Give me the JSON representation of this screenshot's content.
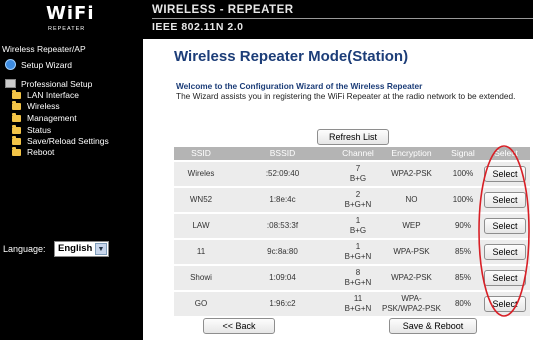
{
  "header": {
    "logo_text": "WiFi",
    "logo_sub": "REPEATER",
    "title": "WIRELESS - REPEATER",
    "subtitle": "IEEE 802.11N 2.0"
  },
  "sidebar": {
    "heading": "Wireless Repeater/AP",
    "items": [
      {
        "label": "Setup Wizard",
        "icon": "globe-icon"
      },
      {
        "label": "Professional Setup",
        "icon": "setup-icon"
      },
      {
        "label": "LAN Interface",
        "icon": "folder-icon"
      },
      {
        "label": "Wireless",
        "icon": "folder-icon"
      },
      {
        "label": "Management",
        "icon": "folder-icon"
      },
      {
        "label": "Status",
        "icon": "folder-icon"
      },
      {
        "label": "Save/Reload Settings",
        "icon": "folder-icon"
      },
      {
        "label": "Reboot",
        "icon": "folder-icon"
      }
    ],
    "language_label": "Language:",
    "language_value": "English"
  },
  "main": {
    "title": "Wireless Repeater Mode(Station)",
    "welcome": "Welcome to the Configuration Wizard of the Wireless Repeater",
    "description": "The Wizard assists you in registering the WiFi Repeater at the radio network to be extended.",
    "refresh_label": "Refresh List",
    "back_label": "<< Back",
    "save_label": "Save & Reboot"
  },
  "table": {
    "headers": [
      "SSID",
      "BSSID",
      "Channel",
      "Encryption",
      "Signal",
      "Select"
    ],
    "rows": [
      {
        "ssid": "Wireles",
        "bssid": ":52:09:40",
        "ch1": "7",
        "ch2": "B+G",
        "enc1": "WPA2-PSK",
        "enc2": "",
        "signal": "100%",
        "select": "Select"
      },
      {
        "ssid": "WN52",
        "bssid": "1:8e:4c",
        "ch1": "2",
        "ch2": "B+G+N",
        "enc1": "NO",
        "enc2": "",
        "signal": "100%",
        "select": "Select"
      },
      {
        "ssid": "LAW",
        "bssid": ":08:53:3f",
        "ch1": "1",
        "ch2": "B+G",
        "enc1": "WEP",
        "enc2": "",
        "signal": "90%",
        "select": "Select"
      },
      {
        "ssid": "11",
        "bssid": "9c:8a:80",
        "ch1": "1",
        "ch2": "B+G+N",
        "enc1": "WPA-PSK",
        "enc2": "",
        "signal": "85%",
        "select": "Select"
      },
      {
        "ssid": "Showi",
        "bssid": "1:09:04",
        "ch1": "8",
        "ch2": "B+G+N",
        "enc1": "WPA2-PSK",
        "enc2": "",
        "signal": "85%",
        "select": "Select"
      },
      {
        "ssid": "GO",
        "bssid": "1:96:c2",
        "ch1": "11",
        "ch2": "B+G+N",
        "enc1": "WPA-",
        "enc2": "PSK/WPA2-PSK",
        "signal": "80%",
        "select": "Select"
      }
    ]
  },
  "colors": {
    "title_blue": "#1c3d78",
    "header_bg": "#000000",
    "annotation_red": "#d81f26"
  }
}
